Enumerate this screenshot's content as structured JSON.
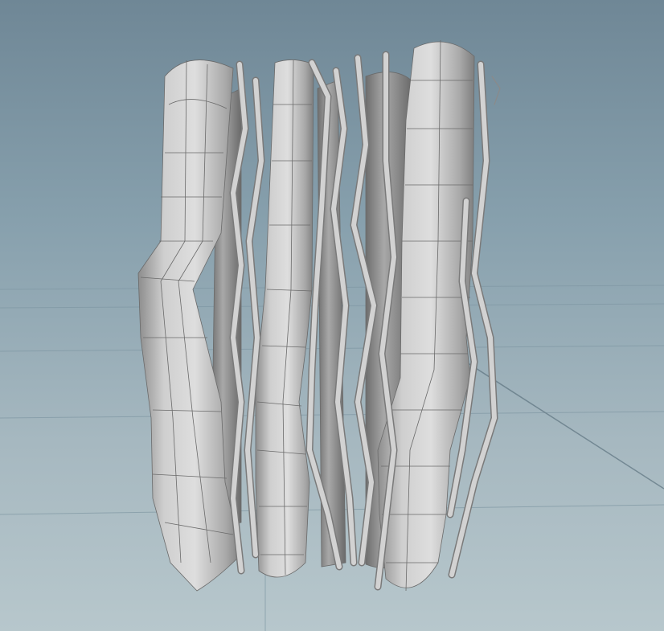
{
  "viewport": {
    "kind": "3d-viewport",
    "background_top": "#6f8796",
    "background_bottom": "#b7c7cc",
    "grid_color": "#7f97a3",
    "axis_color": "#5e7480",
    "mesh_fill": "#c4c4c4",
    "mesh_shade": "#9a9a9a",
    "wire_color": "#6a6a6a"
  },
  "scene": {
    "object": "bundle-of-bent-tubes",
    "shading": "smooth-shaded-with-wireframe"
  }
}
